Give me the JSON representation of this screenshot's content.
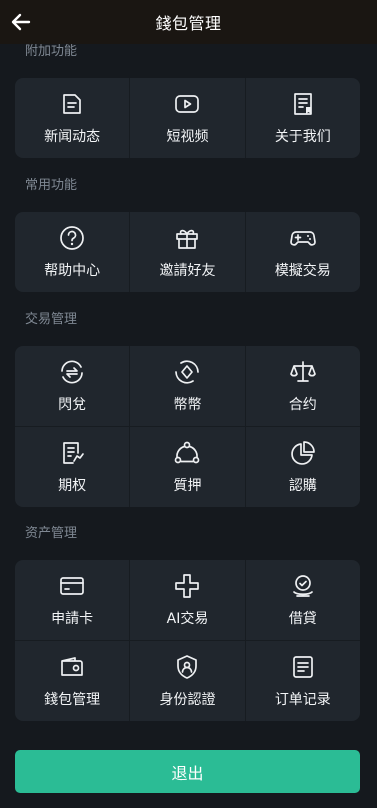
{
  "header": {
    "title": "錢包管理"
  },
  "sections": {
    "extra": {
      "title": "附加功能",
      "items": [
        {
          "label": "新闻动态",
          "icon": "news-icon"
        },
        {
          "label": "短视频",
          "icon": "video-icon"
        },
        {
          "label": "关于我们",
          "icon": "about-icon"
        }
      ]
    },
    "common": {
      "title": "常用功能",
      "items": [
        {
          "label": "帮助中心",
          "icon": "help-icon"
        },
        {
          "label": "邀請好友",
          "icon": "gift-icon"
        },
        {
          "label": "模擬交易",
          "icon": "gamepad-icon"
        }
      ]
    },
    "trade": {
      "title": "交易管理",
      "items": [
        {
          "label": "閃兌",
          "icon": "exchange-icon"
        },
        {
          "label": "幣幣",
          "icon": "coin-swap-icon"
        },
        {
          "label": "合约",
          "icon": "scale-icon"
        },
        {
          "label": "期权",
          "icon": "options-icon"
        },
        {
          "label": "質押",
          "icon": "staking-icon"
        },
        {
          "label": "認購",
          "icon": "pie-chart-icon"
        }
      ]
    },
    "assets": {
      "title": "资产管理",
      "items": [
        {
          "label": "申請卡",
          "icon": "card-icon"
        },
        {
          "label": "AI交易",
          "icon": "ai-trade-icon"
        },
        {
          "label": "借貸",
          "icon": "loan-icon"
        },
        {
          "label": "錢包管理",
          "icon": "wallet-icon"
        },
        {
          "label": "身份認證",
          "icon": "identity-icon"
        },
        {
          "label": "订单记录",
          "icon": "order-icon"
        }
      ]
    }
  },
  "logout_label": "退出",
  "colors": {
    "accent": "#2bbc95",
    "card": "#20262d",
    "background": "#15191e"
  }
}
